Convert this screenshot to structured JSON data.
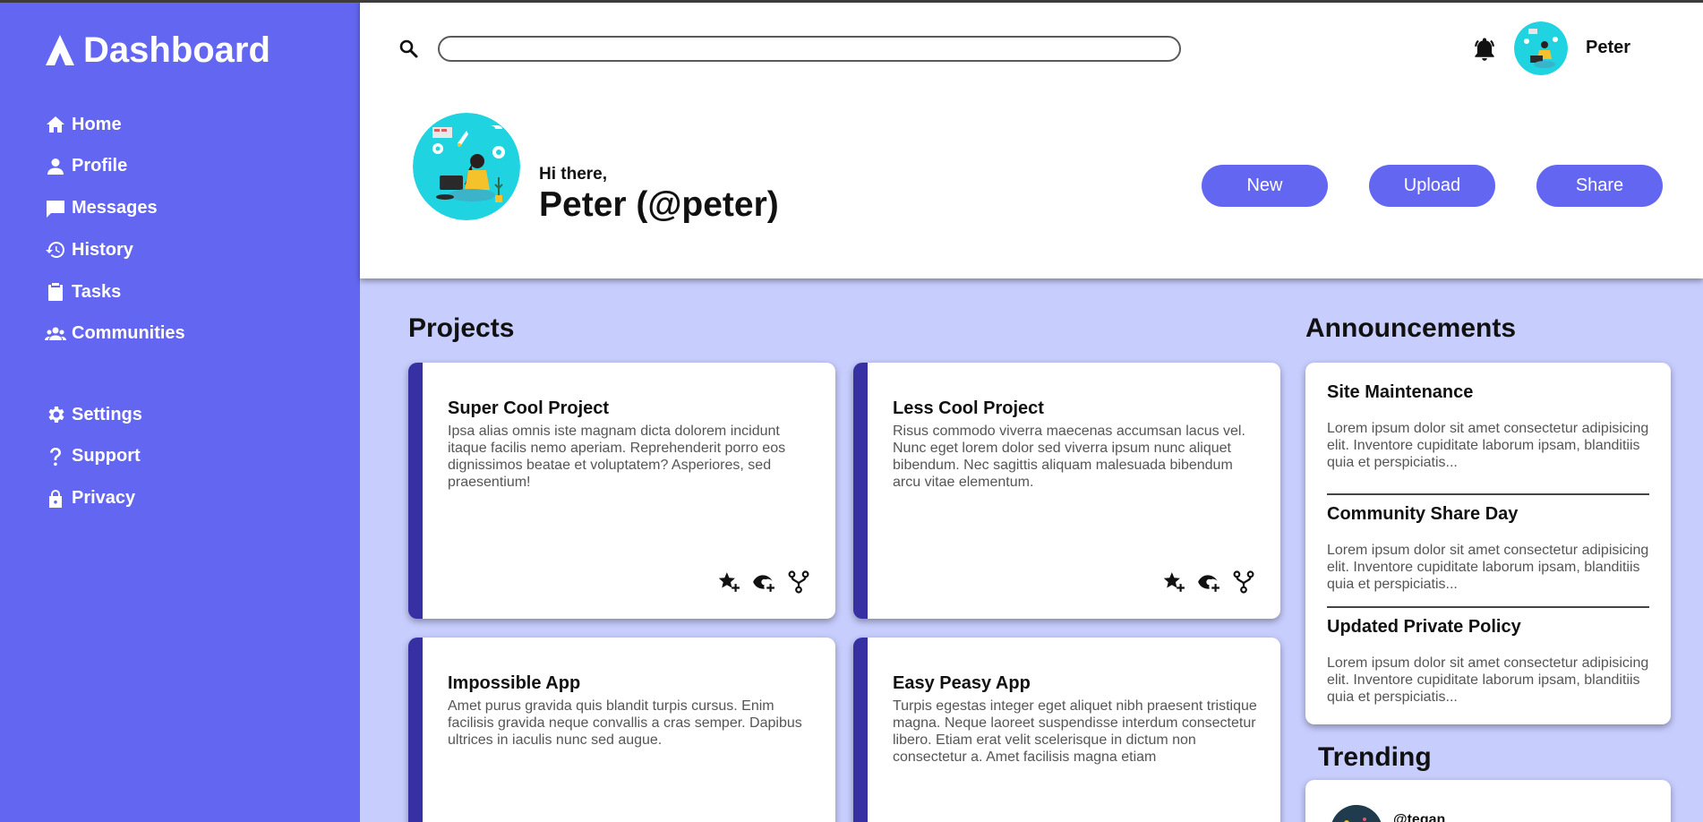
{
  "brand": {
    "title": "Dashboard"
  },
  "sidebar": {
    "primary": [
      {
        "label": "Home",
        "icon": "home-icon"
      },
      {
        "label": "Profile",
        "icon": "person-icon"
      },
      {
        "label": "Messages",
        "icon": "chat-icon"
      },
      {
        "label": "History",
        "icon": "history-icon"
      },
      {
        "label": "Tasks",
        "icon": "clipboard-icon"
      },
      {
        "label": "Communities",
        "icon": "group-icon"
      }
    ],
    "secondary": [
      {
        "label": "Settings",
        "icon": "gear-icon"
      },
      {
        "label": "Support",
        "icon": "question-icon"
      },
      {
        "label": "Privacy",
        "icon": "lock-icon"
      }
    ]
  },
  "header": {
    "search": {
      "value": "",
      "placeholder": ""
    },
    "user_name": "Peter",
    "greeting": "Hi there,",
    "full_name": "Peter (@peter)",
    "buttons": {
      "new": "New",
      "upload": "Upload",
      "share": "Share"
    }
  },
  "projects": {
    "title": "Projects",
    "items": [
      {
        "title": "Super Cool Project",
        "desc": "Ipsa alias omnis iste magnam dicta dolorem incidunt itaque facilis nemo aperiam. Reprehenderit porro eos dignissimos beatae et voluptatem? Asperiores, sed praesentium!"
      },
      {
        "title": "Less Cool Project",
        "desc": "Risus commodo viverra maecenas accumsan lacus vel. Nunc eget lorem dolor sed viverra ipsum nunc aliquet bibendum. Nec sagittis aliquam malesuada bibendum arcu vitae elementum."
      },
      {
        "title": "Impossible App",
        "desc": "Amet purus gravida quis blandit turpis cursus. Enim facilisis gravida neque convallis a cras semper. Dapibus ultrices in iaculis nunc sed augue."
      },
      {
        "title": "Easy Peasy App",
        "desc": "Turpis egestas integer eget aliquet nibh praesent tristique magna. Neque laoreet suspendisse interdum consectetur libero. Etiam erat velit scelerisque in dictum non consectetur a. Amet facilisis magna etiam"
      }
    ]
  },
  "announcements": {
    "title": "Announcements",
    "items": [
      {
        "title": "Site Maintenance",
        "text": "Lorem ipsum dolor sit amet consectetur adipisicing elit. Inventore cupiditate laborum ipsam, blanditiis quia et perspiciatis..."
      },
      {
        "title": "Community Share Day",
        "text": "Lorem ipsum dolor sit amet consectetur adipisicing elit. Inventore cupiditate laborum ipsam, blanditiis quia et perspiciatis..."
      },
      {
        "title": "Updated Private Policy",
        "text": "Lorem ipsum dolor sit amet consectetur adipisicing elit. Inventore cupiditate laborum ipsam, blanditiis quia et perspiciatis..."
      }
    ]
  },
  "trending": {
    "title": "Trending",
    "items": [
      {
        "handle": "@tegan"
      }
    ]
  },
  "colors": {
    "sidebar": "#6366f1",
    "accent": "#3730a3",
    "background": "#c7cdfd",
    "avatar_bg": "#1fd3e0"
  }
}
